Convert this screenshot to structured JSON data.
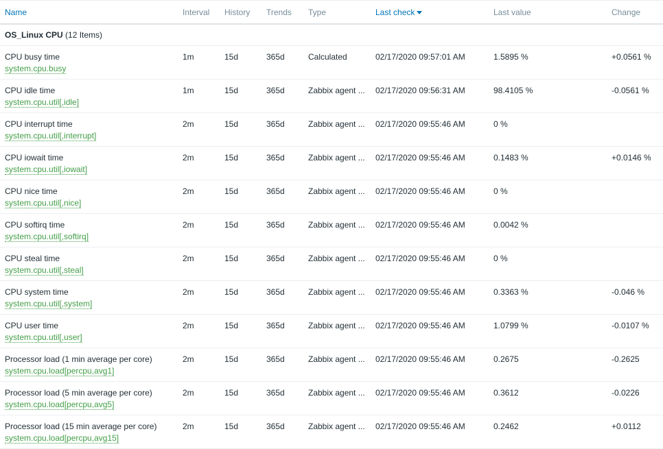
{
  "headers": {
    "name": "Name",
    "interval": "Interval",
    "history": "History",
    "trends": "Trends",
    "type": "Type",
    "last_check": "Last check",
    "last_value": "Last value",
    "change": "Change"
  },
  "group": {
    "name": "OS_Linux CPU",
    "count": "(12 Items)"
  },
  "items": [
    {
      "name": "CPU busy time",
      "key": "system.cpu.busy",
      "interval": "1m",
      "history": "15d",
      "trends": "365d",
      "type": "Calculated",
      "last_check": "02/17/2020 09:57:01 AM",
      "last_value": "1.5895 %",
      "change": "+0.0561 %"
    },
    {
      "name": "CPU idle time",
      "key": "system.cpu.util[,idle]",
      "interval": "1m",
      "history": "15d",
      "trends": "365d",
      "type": "Zabbix agent ...",
      "last_check": "02/17/2020 09:56:31 AM",
      "last_value": "98.4105 %",
      "change": "-0.0561 %"
    },
    {
      "name": "CPU interrupt time",
      "key": "system.cpu.util[,interrupt]",
      "interval": "2m",
      "history": "15d",
      "trends": "365d",
      "type": "Zabbix agent ...",
      "last_check": "02/17/2020 09:55:46 AM",
      "last_value": "0 %",
      "change": ""
    },
    {
      "name": "CPU iowait time",
      "key": "system.cpu.util[,iowait]",
      "interval": "2m",
      "history": "15d",
      "trends": "365d",
      "type": "Zabbix agent ...",
      "last_check": "02/17/2020 09:55:46 AM",
      "last_value": "0.1483 %",
      "change": "+0.0146 %"
    },
    {
      "name": "CPU nice time",
      "key": "system.cpu.util[,nice]",
      "interval": "2m",
      "history": "15d",
      "trends": "365d",
      "type": "Zabbix agent ...",
      "last_check": "02/17/2020 09:55:46 AM",
      "last_value": "0 %",
      "change": ""
    },
    {
      "name": "CPU softirq time",
      "key": "system.cpu.util[,softirq]",
      "interval": "2m",
      "history": "15d",
      "trends": "365d",
      "type": "Zabbix agent ...",
      "last_check": "02/17/2020 09:55:46 AM",
      "last_value": "0.0042 %",
      "change": ""
    },
    {
      "name": "CPU steal time",
      "key": "system.cpu.util[,steal]",
      "interval": "2m",
      "history": "15d",
      "trends": "365d",
      "type": "Zabbix agent ...",
      "last_check": "02/17/2020 09:55:46 AM",
      "last_value": "0 %",
      "change": ""
    },
    {
      "name": "CPU system time",
      "key": "system.cpu.util[,system]",
      "interval": "2m",
      "history": "15d",
      "trends": "365d",
      "type": "Zabbix agent ...",
      "last_check": "02/17/2020 09:55:46 AM",
      "last_value": "0.3363 %",
      "change": "-0.046 %"
    },
    {
      "name": "CPU user time",
      "key": "system.cpu.util[,user]",
      "interval": "2m",
      "history": "15d",
      "trends": "365d",
      "type": "Zabbix agent ...",
      "last_check": "02/17/2020 09:55:46 AM",
      "last_value": "1.0799 %",
      "change": "-0.0107 %"
    },
    {
      "name": "Processor load (1 min average per core)",
      "key": "system.cpu.load[percpu,avg1]",
      "interval": "2m",
      "history": "15d",
      "trends": "365d",
      "type": "Zabbix agent ...",
      "last_check": "02/17/2020 09:55:46 AM",
      "last_value": "0.2675",
      "change": "-0.2625"
    },
    {
      "name": "Processor load (5 min average per core)",
      "key": "system.cpu.load[percpu,avg5]",
      "interval": "2m",
      "history": "15d",
      "trends": "365d",
      "type": "Zabbix agent ...",
      "last_check": "02/17/2020 09:55:46 AM",
      "last_value": "0.3612",
      "change": "-0.0226"
    },
    {
      "name": "Processor load (15 min average per core)",
      "key": "system.cpu.load[percpu,avg15]",
      "interval": "2m",
      "history": "15d",
      "trends": "365d",
      "type": "Zabbix agent ...",
      "last_check": "02/17/2020 09:55:46 AM",
      "last_value": "0.2462",
      "change": "+0.0112"
    }
  ]
}
